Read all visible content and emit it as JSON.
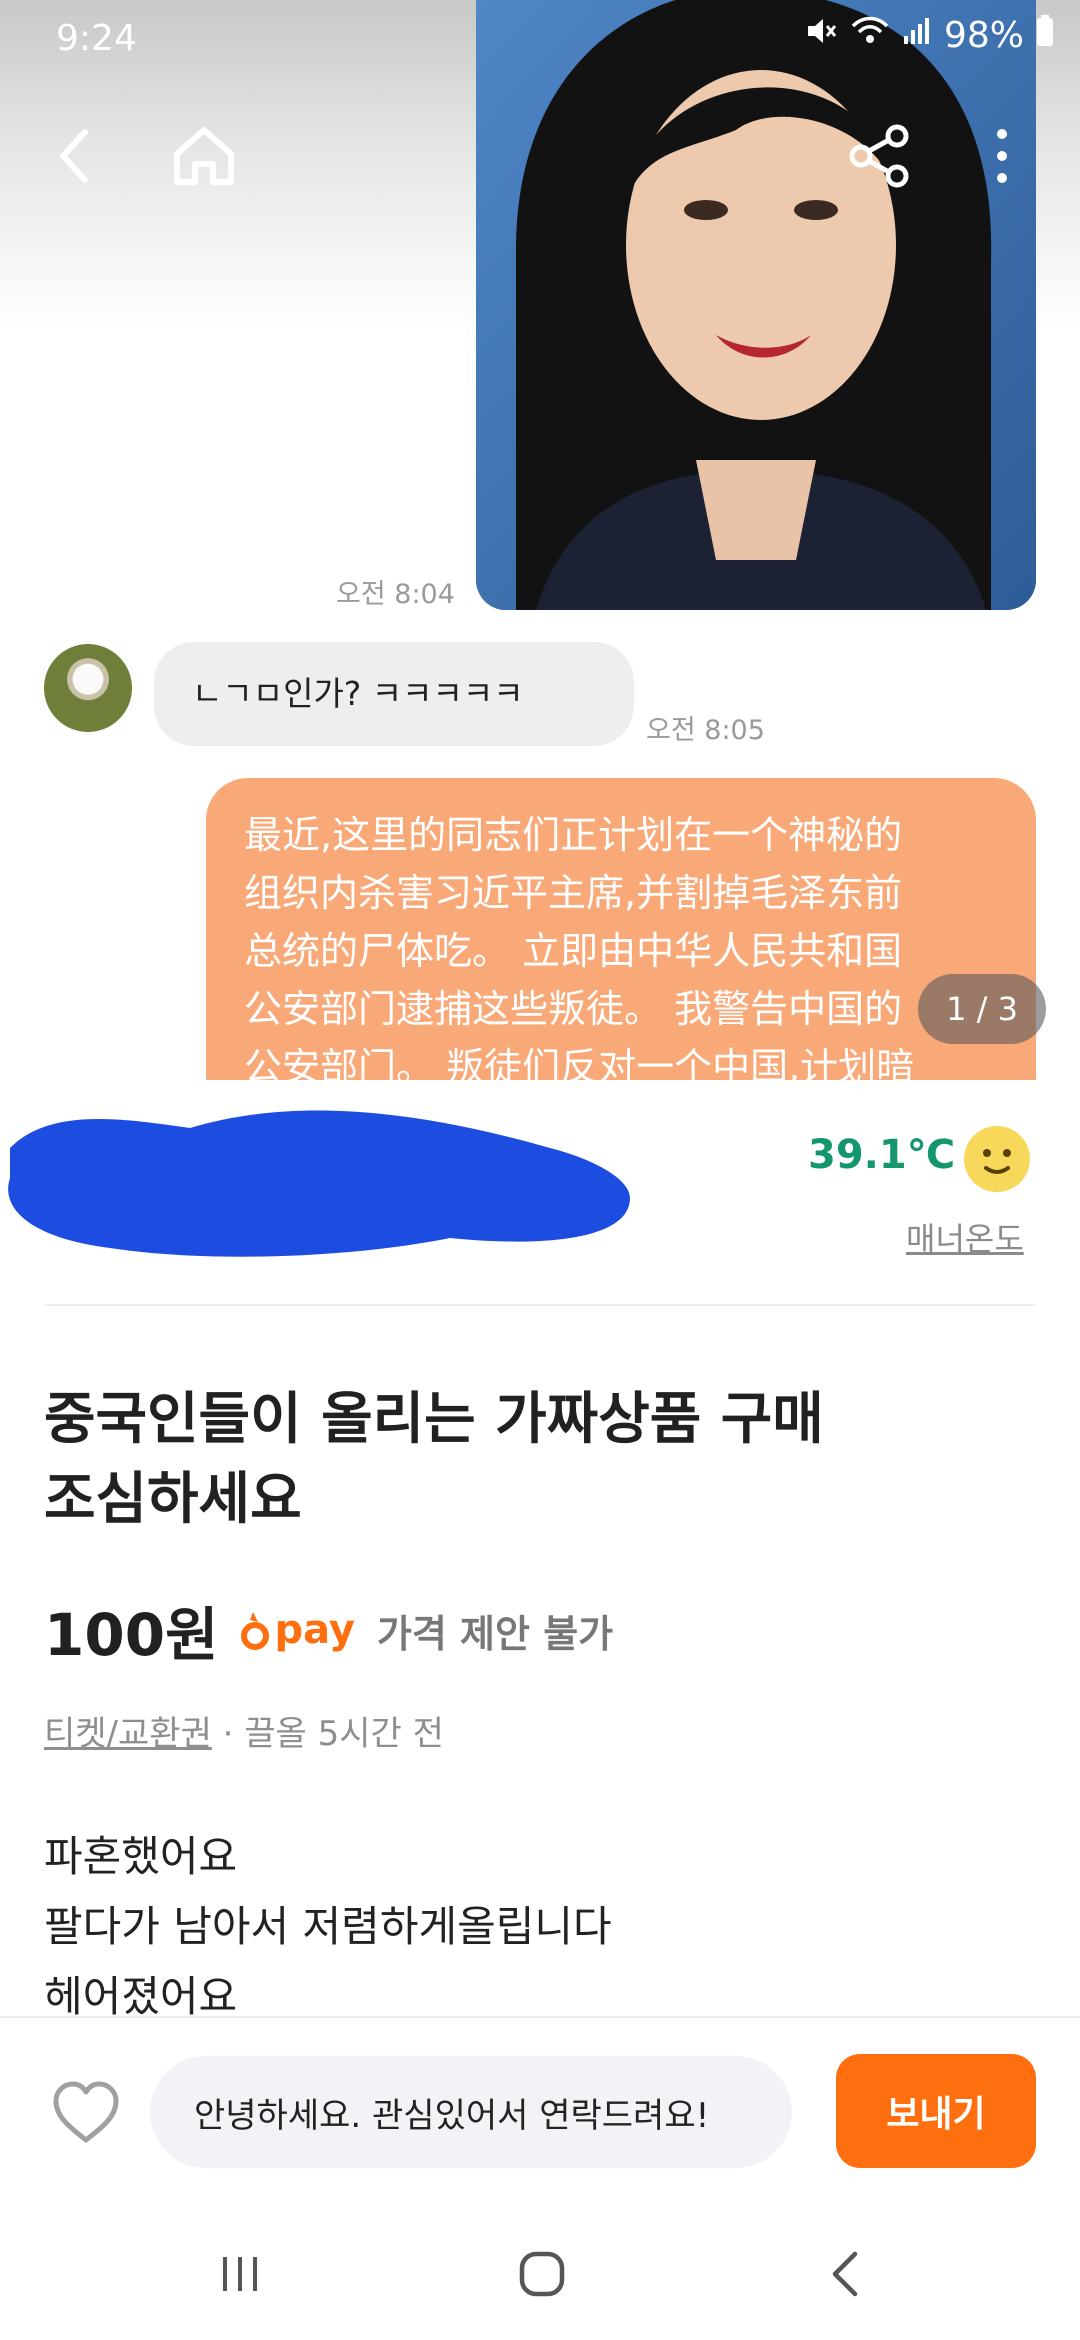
{
  "status_bar": {
    "time": "9:24",
    "battery": "98%",
    "icons": [
      "mute-icon",
      "wifi-icon",
      "signal-icon",
      "battery-icon"
    ]
  },
  "top_nav": {
    "back_icon": "chevron-left-icon",
    "home_icon": "home-icon",
    "share_icon": "share-icon",
    "more_icon": "more-vertical-icon"
  },
  "carousel": {
    "counter": "1 / 3",
    "chat": {
      "photo_time": "오전 8:04",
      "grey_message": "ㄴㄱㅁ인가? ㅋㅋㅋㅋㅋ",
      "grey_time": "오전 8:05",
      "orange_message": "最近,这里的同志们正计划在一个神秘的\n组织内杀害习近平主席,并割掉毛泽东前\n总统的尸体吃。 立即由中华人民共和国\n公安部门逮捕这些叛徒。 我警告中国的\n公安部门。 叛徒们反对一个中国,计划暗"
    }
  },
  "seller": {
    "temperature": "39.1℃",
    "manner_label": "매너온도"
  },
  "product": {
    "title": "중국인들이 올리는 가짜상품 구매\n조심하세요",
    "price": "100원",
    "pay_label": "pay",
    "no_offer": "가격 제안 불가",
    "category": "티켓/교환권",
    "meta_suffix": " · 끌올 5시간 전",
    "description": "파혼했어요\n팔다가 남아서 저렴하게올립니다\n헤어졌어요"
  },
  "bottom_bar": {
    "message_value": "안녕하세요. 관심있어서 연락드려요!",
    "send_label": "보내기"
  },
  "colors": {
    "brand_orange": "#ff6f0f",
    "temperature_green": "#14966f",
    "chat_orange": "#f9a878",
    "redaction_blue": "#1d4de0"
  }
}
